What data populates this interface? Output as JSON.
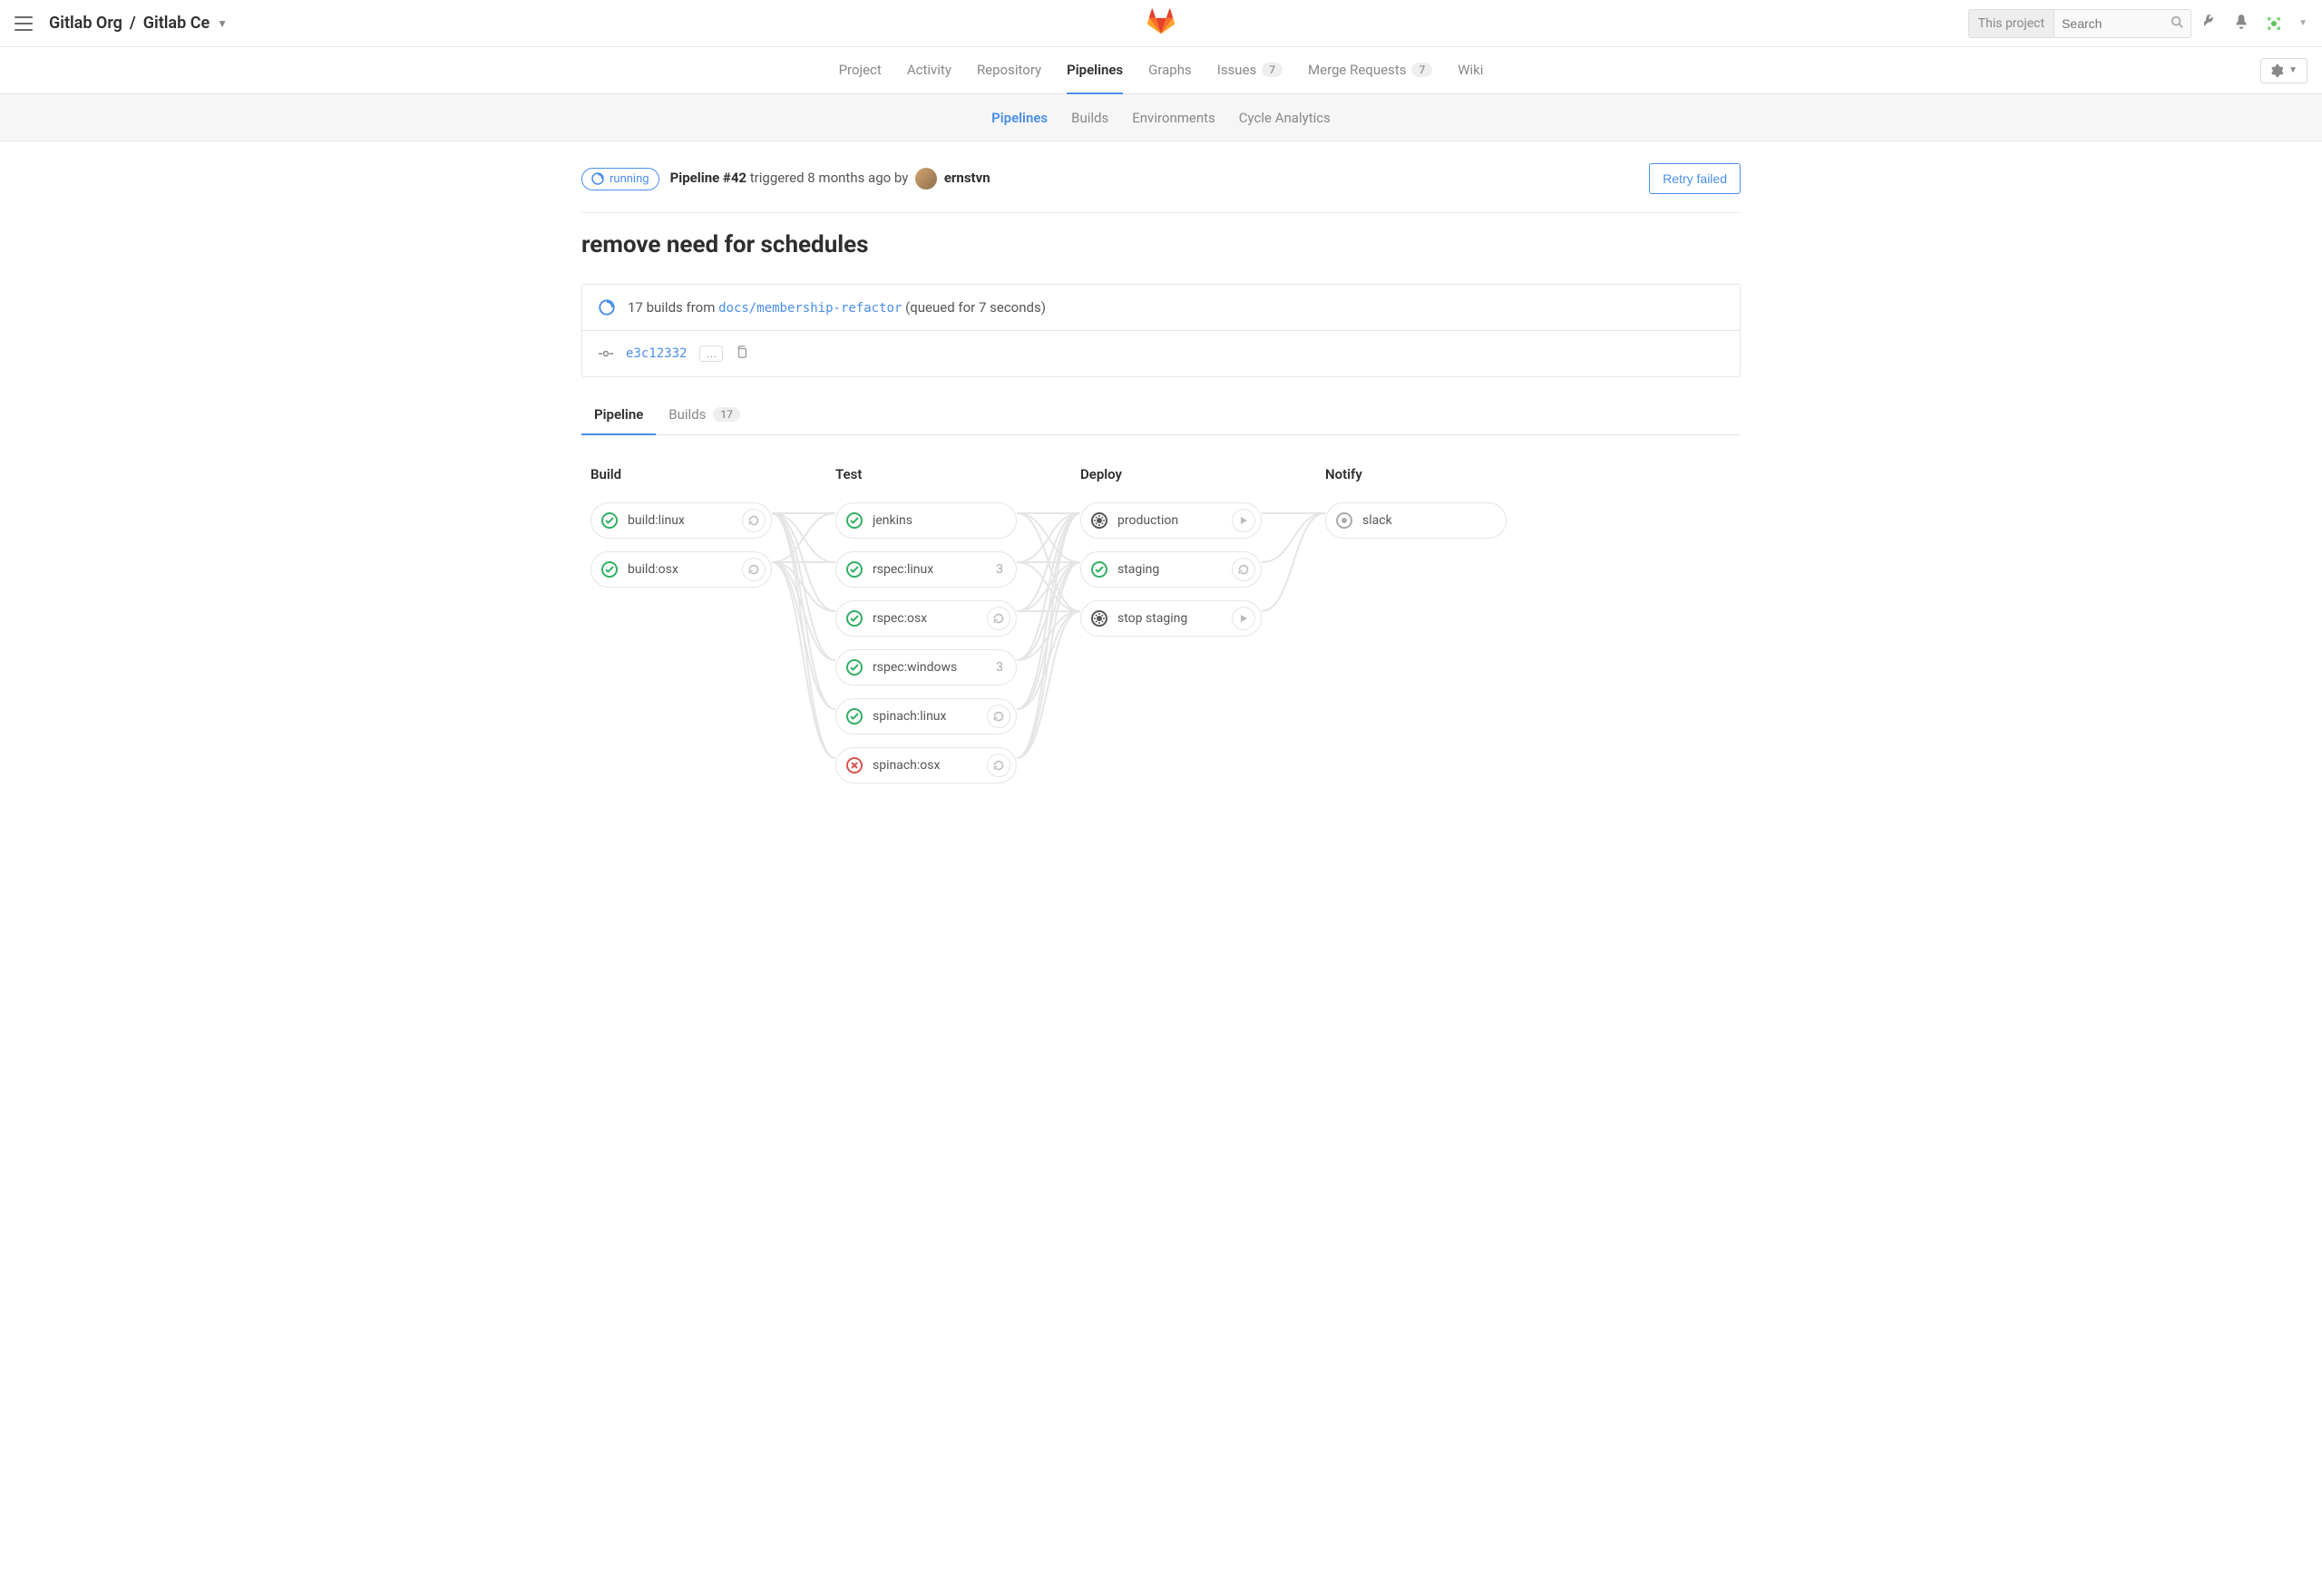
{
  "header": {
    "breadcrumb_group": "Gitlab Org",
    "breadcrumb_project": "Gitlab Ce",
    "search_scope": "This project",
    "search_placeholder": "Search"
  },
  "nav": {
    "items": [
      {
        "label": "Project"
      },
      {
        "label": "Activity"
      },
      {
        "label": "Repository"
      },
      {
        "label": "Pipelines",
        "active": true
      },
      {
        "label": "Graphs"
      },
      {
        "label": "Issues",
        "count": "7"
      },
      {
        "label": "Merge Requests",
        "count": "7"
      },
      {
        "label": "Wiki"
      }
    ]
  },
  "subnav": {
    "items": [
      {
        "label": "Pipelines",
        "active": true
      },
      {
        "label": "Builds"
      },
      {
        "label": "Environments"
      },
      {
        "label": "Cycle Analytics"
      }
    ]
  },
  "pipeline": {
    "status": "running",
    "id_label": "Pipeline #42",
    "triggered_text": "triggered 8 months ago by",
    "user": "ernstvn",
    "retry_label": "Retry failed",
    "commit_title": "remove need for schedules",
    "builds_prefix": "17 builds from",
    "branch": "docs/membership-refactor",
    "queued_text": "(queued for 7 seconds)",
    "sha": "e3c12332"
  },
  "view_tabs": {
    "pipeline": "Pipeline",
    "builds": "Builds",
    "builds_count": "17"
  },
  "stages": [
    {
      "name": "Build",
      "jobs": [
        {
          "name": "build:linux",
          "status": "success",
          "action": "retry"
        },
        {
          "name": "build:osx",
          "status": "success",
          "action": "retry"
        }
      ]
    },
    {
      "name": "Test",
      "jobs": [
        {
          "name": "jenkins",
          "status": "success"
        },
        {
          "name": "rspec:linux",
          "status": "success",
          "count": "3"
        },
        {
          "name": "rspec:osx",
          "status": "success",
          "action": "retry"
        },
        {
          "name": "rspec:windows",
          "status": "success",
          "count": "3"
        },
        {
          "name": "spinach:linux",
          "status": "success",
          "action": "retry"
        },
        {
          "name": "spinach:osx",
          "status": "failed",
          "action": "retry"
        }
      ]
    },
    {
      "name": "Deploy",
      "jobs": [
        {
          "name": "production",
          "status": "manual",
          "action": "play"
        },
        {
          "name": "staging",
          "status": "success",
          "action": "retry"
        },
        {
          "name": "stop staging",
          "status": "manual",
          "action": "play"
        }
      ]
    },
    {
      "name": "Notify",
      "jobs": [
        {
          "name": "slack",
          "status": "skipped"
        }
      ]
    }
  ]
}
